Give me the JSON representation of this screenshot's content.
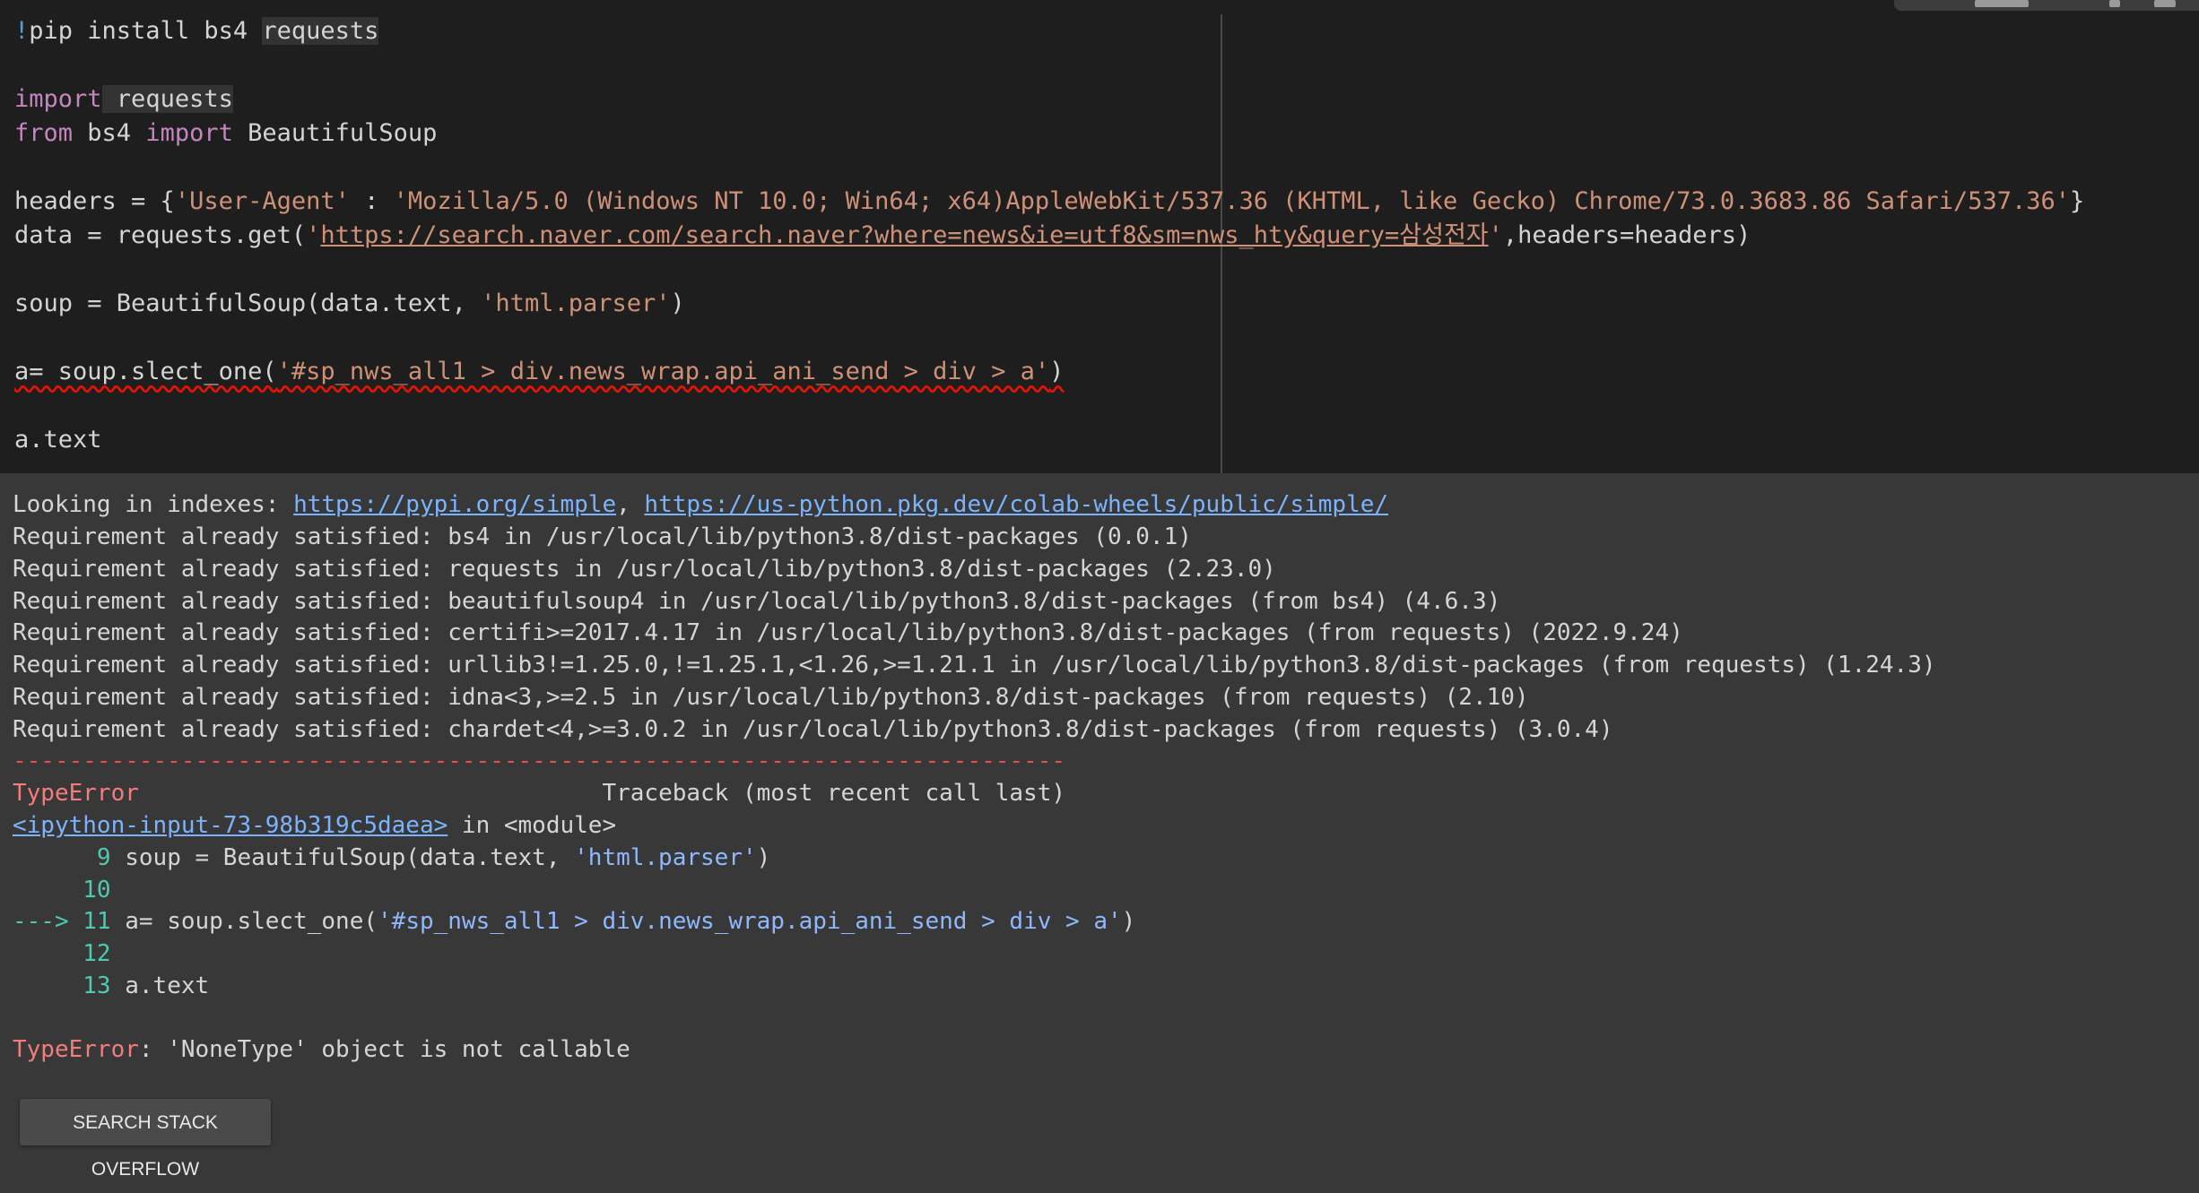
{
  "code_cell": {
    "line1": {
      "bang": "!",
      "cmd": "pip install bs4 ",
      "pkg": "requests"
    },
    "line3": {
      "kw": "import",
      "rest": " requests"
    },
    "line4": {
      "kw1": "from",
      "mid": " bs4 ",
      "kw2": "import",
      "rest": " BeautifulSoup"
    },
    "line6": {
      "pre": "headers = {",
      "key": "'User-Agent'",
      "sep": " : ",
      "val": "'Mozilla/5.0 (Windows NT 10.0; Win64; x64)AppleWebKit/537.36 (KHTML, like Gecko) Chrome/73.0.3683.86 Safari/537.36'",
      "post": "}"
    },
    "line7": {
      "pre": "data = requests.get(",
      "q1": "'",
      "url": "https://search.naver.com/search.naver?where=news&ie=utf8&sm=nws_hty&query=삼성전자",
      "q2": "'",
      "post": ",headers=headers)"
    },
    "line9": {
      "pre": "soup = BeautifulSoup(data.text, ",
      "str": "'html.parser'",
      "post": ")"
    },
    "line11": {
      "pre": "a= soup.slect_one(",
      "str": "'#sp_nws_all1 > div.news_wrap.api_ani_send > div > a'",
      "post": ")"
    },
    "line13": "a.text"
  },
  "output": {
    "looking": {
      "label": "Looking in indexes: ",
      "link1": "https://pypi.org/simple",
      "comma": ", ",
      "link2": "https://us-python.pkg.dev/colab-wheels/public/simple/"
    },
    "requirements": [
      "Requirement already satisfied: bs4 in /usr/local/lib/python3.8/dist-packages (0.0.1)",
      "Requirement already satisfied: requests in /usr/local/lib/python3.8/dist-packages (2.23.0)",
      "Requirement already satisfied: beautifulsoup4 in /usr/local/lib/python3.8/dist-packages (from bs4) (4.6.3)",
      "Requirement already satisfied: certifi>=2017.4.17 in /usr/local/lib/python3.8/dist-packages (from requests) (2022.9.24)",
      "Requirement already satisfied: urllib3!=1.25.0,!=1.25.1,<1.26,>=1.21.1 in /usr/local/lib/python3.8/dist-packages (from requests) (1.24.3)",
      "Requirement already satisfied: idna<3,>=2.5 in /usr/local/lib/python3.8/dist-packages (from requests) (2.10)",
      "Requirement already satisfied: chardet<4,>=3.0.2 in /usr/local/lib/python3.8/dist-packages (from requests) (3.0.4)"
    ],
    "dashes": "---------------------------------------------------------------------------",
    "tb_header": {
      "err": "TypeError",
      "gap": "                                 ",
      "text": "Traceback (most recent call last)"
    },
    "tb_location": {
      "link": "<ipython-input-73-98b319c5daea>",
      "rest": " in <module>"
    },
    "tb_lines": [
      {
        "prefix": "      ",
        "num": "9",
        "pre": " soup = BeautifulSoup(data.text, ",
        "str": "'html.parser'",
        "post": ")"
      },
      {
        "prefix": "     ",
        "num": "10",
        "pre": "",
        "str": "",
        "post": ""
      },
      {
        "prefix": "---> ",
        "num": "11",
        "pre": " a= soup.slect_one(",
        "str": "'#sp_nws_all1 > div.news_wrap.api_ani_send > div > a'",
        "post": ")"
      },
      {
        "prefix": "     ",
        "num": "12",
        "pre": "",
        "str": "",
        "post": ""
      },
      {
        "prefix": "     ",
        "num": "13",
        "pre": " a.text",
        "str": "",
        "post": ""
      }
    ],
    "error": {
      "type": "TypeError",
      "msg": ": 'NoneType' object is not callable"
    },
    "so_button": "SEARCH STACK OVERFLOW"
  }
}
